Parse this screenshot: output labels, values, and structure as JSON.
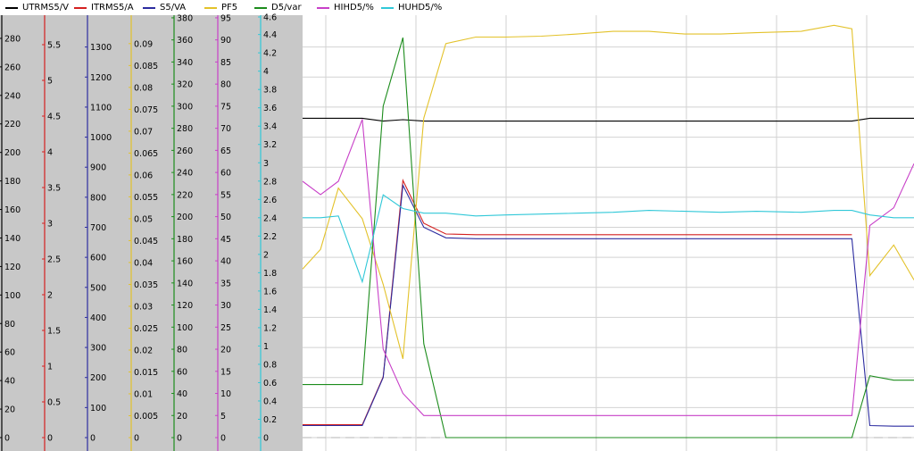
{
  "legend": [
    {
      "label": "UTRMS5/V",
      "color": "#000000"
    },
    {
      "label": "ITRMS5/A",
      "color": "#d42020"
    },
    {
      "label": "S5/VA",
      "color": "#2c2ca0"
    },
    {
      "label": "PF5",
      "color": "#e3c22a"
    },
    {
      "label": "D5/var",
      "color": "#1c8c1c"
    },
    {
      "label": "HIHD5/%",
      "color": "#c840c8"
    },
    {
      "label": "HUHD5/%",
      "color": "#30c8d8"
    }
  ],
  "chart_data": {
    "type": "line",
    "grid": true,
    "axes": [
      {
        "name": "UTRMS5/V",
        "color": "#000000",
        "ticks": [
          "0",
          "20",
          "40",
          "60",
          "80",
          "100",
          "120",
          "140",
          "160",
          "180",
          "200",
          "220",
          "240",
          "260",
          "280"
        ],
        "range": [
          0,
          300
        ]
      },
      {
        "name": "ITRMS5/A",
        "color": "#d42020",
        "ticks": [
          "0",
          "0.5",
          "1",
          "1.5",
          "2",
          "2.5",
          "3",
          "3.5",
          "4",
          "4.5",
          "5",
          "5.5"
        ],
        "range": [
          0,
          6
        ]
      },
      {
        "name": "S5/VA",
        "color": "#2c2ca0",
        "ticks": [
          "0",
          "100",
          "200",
          "300",
          "400",
          "500",
          "600",
          "700",
          "800",
          "900",
          "1000",
          "1100",
          "1200",
          "1300"
        ],
        "range": [
          0,
          1400
        ]
      },
      {
        "name": "PF5",
        "color": "#e3c22a",
        "ticks": [
          "0",
          "0.005",
          "0.01",
          "0.015",
          "0.02",
          "0.025",
          "0.03",
          "0.035",
          "0.04",
          "0.045",
          "0.05",
          "0.055",
          "0.06",
          "0.065",
          "0.07",
          "0.075",
          "0.08",
          "0.085",
          "0.09"
        ],
        "range": [
          0,
          0.095
        ]
      },
      {
        "name": "D5/var",
        "color": "#1c8c1c",
        "ticks": [
          "0",
          "20",
          "40",
          "60",
          "80",
          "100",
          "120",
          "140",
          "160",
          "180",
          "200",
          "220",
          "240",
          "260",
          "280",
          "300",
          "320",
          "340",
          "360",
          "380"
        ],
        "range": [
          0,
          380
        ]
      },
      {
        "name": "HIHD5/%",
        "color": "#c840c8",
        "ticks": [
          "0",
          "5",
          "10",
          "15",
          "20",
          "25",
          "30",
          "35",
          "40",
          "45",
          "50",
          "55",
          "60",
          "65",
          "70",
          "75",
          "80",
          "85",
          "90",
          "95"
        ],
        "range": [
          0,
          95
        ]
      },
      {
        "name": "HUHD5/%",
        "color": "#30c8d8",
        "ticks": [
          "0",
          "0.2",
          "0.4",
          "0.6",
          "0.8",
          "1",
          "1.2",
          "1.4",
          "1.6",
          "1.8",
          "2",
          "2.2",
          "2.4",
          "2.6",
          "2.8",
          "3",
          "3.2",
          "3.4",
          "3.6",
          "3.8",
          "4",
          "4.2",
          "4.4",
          "4.6"
        ],
        "range": [
          0,
          4.6
        ]
      }
    ],
    "x": [
      0,
      30,
      60,
      100,
      135,
      168,
      203,
      240,
      290,
      340,
      400,
      460,
      520,
      580,
      640,
      700,
      760,
      835,
      890,
      920,
      950,
      990,
      1024
    ],
    "series": [
      {
        "name": "UTRMS5/V",
        "color": "#000000",
        "values": [
          224,
          224,
          224,
          224,
          222,
          223,
          222,
          222,
          222,
          222,
          222,
          222,
          222,
          222,
          222,
          222,
          222,
          222,
          222,
          222,
          224,
          224,
          224
        ]
      },
      {
        "name": "ITRMS5/A",
        "color": "#d42020",
        "values": [
          0.18,
          0.18,
          0.18,
          0.18,
          0.85,
          3.6,
          3.0,
          2.85,
          2.84,
          2.84,
          2.84,
          2.84,
          2.84,
          2.84,
          2.84,
          2.84,
          2.84,
          2.84,
          2.84,
          2.84,
          null,
          null,
          null
        ]
      },
      {
        "name": "S5/VA",
        "color": "#2c2ca0",
        "values": [
          40,
          40,
          40,
          40,
          200,
          840,
          700,
          665,
          662,
          662,
          662,
          662,
          662,
          662,
          662,
          662,
          662,
          662,
          662,
          662,
          40,
          38,
          38
        ]
      },
      {
        "name": "PF5",
        "color": "#e3c22a",
        "values": [
          0.0385,
          0.043,
          0.057,
          0.05,
          0.035,
          0.018,
          0.073,
          0.09,
          0.0915,
          0.0915,
          0.0917,
          0.0922,
          0.0928,
          0.0928,
          0.0922,
          0.0922,
          0.0925,
          0.0928,
          0.0942,
          0.0934,
          0.037,
          0.044,
          0.036
        ]
      },
      {
        "name": "D5/var",
        "color": "#1c8c1c",
        "values": [
          48,
          48,
          48,
          48,
          300,
          362,
          85,
          0,
          0,
          0,
          0,
          0,
          0,
          0,
          0,
          0,
          0,
          0,
          0,
          0,
          56,
          52,
          52
        ]
      },
      {
        "name": "HIHD5/%",
        "color": "#c840c8",
        "values": [
          58,
          55,
          58,
          72,
          20,
          10,
          5,
          5,
          5,
          5,
          5,
          5,
          5,
          5,
          5,
          5,
          5,
          5,
          5,
          5,
          48,
          52,
          62
        ]
      },
      {
        "name": "HUHD5/%",
        "color": "#30c8d8",
        "values": [
          2.4,
          2.4,
          2.42,
          1.7,
          2.65,
          2.5,
          2.45,
          2.45,
          2.42,
          2.43,
          2.44,
          2.45,
          2.46,
          2.48,
          2.47,
          2.46,
          2.47,
          2.46,
          2.48,
          2.48,
          2.43,
          2.4,
          2.4
        ]
      }
    ]
  }
}
